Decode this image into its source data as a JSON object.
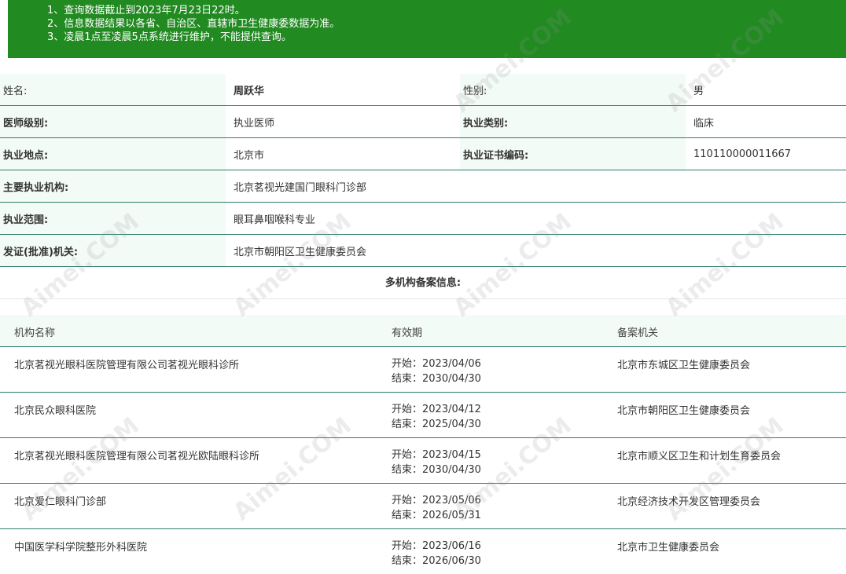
{
  "notice": [
    "1、查询数据截止到2023年7月23日22时。",
    "2、信息数据结果以各省、自治区、直辖市卫生健康委数据为准。",
    "3、凌晨1点至凌晨5点系统进行维护，不能提供查询。"
  ],
  "info": {
    "name_label": "姓名:",
    "name_value": "周跃华",
    "gender_label": "性别:",
    "gender_value": "男",
    "level_label": "医师级别:",
    "level_value": "执业医师",
    "category_label": "执业类别:",
    "category_value": "临床",
    "location_label": "执业地点:",
    "location_value": "北京市",
    "cert_label": "执业证书编码:",
    "cert_value": "110110000011667",
    "institution_label": "主要执业机构:",
    "institution_value": "北京茗视光建国门眼科门诊部",
    "scope_label": "执业范围:",
    "scope_value": "眼耳鼻咽喉科专业",
    "issuer_label": "发证(批准)机关:",
    "issuer_value": "北京市朝阳区卫生健康委员会"
  },
  "records": {
    "title": "多机构备案信息:",
    "headers": [
      "机构名称",
      "有效期",
      "备案机关"
    ],
    "rows": [
      {
        "name": "北京茗视光眼科医院管理有限公司茗视光眼科诊所",
        "start": "开始：2023/04/06",
        "end": "结束：2030/04/30",
        "authority": "北京市东城区卫生健康委员会"
      },
      {
        "name": "北京民众眼科医院",
        "start": "开始：2023/04/12",
        "end": "结束：2025/04/30",
        "authority": "北京市朝阳区卫生健康委员会"
      },
      {
        "name": "北京茗视光眼科医院管理有限公司茗视光欧陆眼科诊所",
        "start": "开始：2023/04/15",
        "end": "结束：2030/04/30",
        "authority": "北京市顺义区卫生和计划生育委员会"
      },
      {
        "name": "北京爱仁眼科门诊部",
        "start": "开始：2023/05/06",
        "end": "结束：2026/05/31",
        "authority": "北京经济技术开发区管理委员会"
      },
      {
        "name": "中国医学科学院整形外科医院",
        "start": "开始：2023/06/16",
        "end": "结束：2026/06/30",
        "authority": "北京市卫生健康委员会"
      }
    ]
  },
  "watermark": "Aimei.COM"
}
